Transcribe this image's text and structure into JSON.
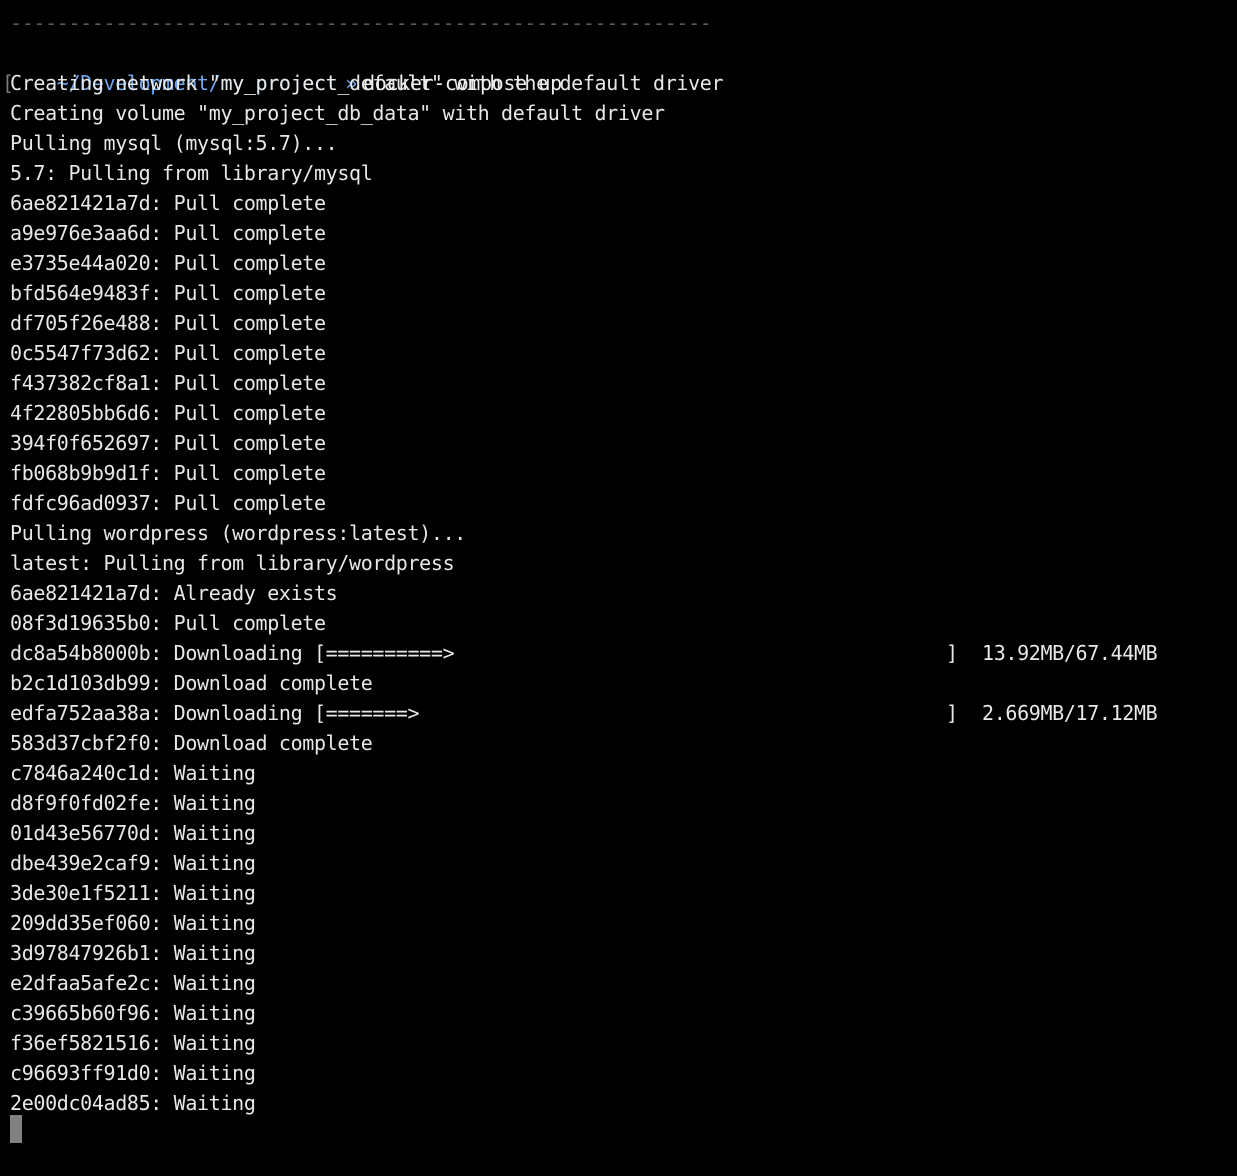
{
  "separator": "------------------------------------------------------------",
  "prompt": {
    "bracket": "[",
    "path": "~/Development/my_project",
    "arrow": "»",
    "command": "docker-compose up"
  },
  "lines": [
    "Creating network \"my_project_default\" with the default driver",
    "Creating volume \"my_project_db_data\" with default driver",
    "Pulling mysql (mysql:5.7)...",
    "5.7: Pulling from library/mysql",
    "6ae821421a7d: Pull complete",
    "a9e976e3aa6d: Pull complete",
    "e3735e44a020: Pull complete",
    "bfd564e9483f: Pull complete",
    "df705f26e488: Pull complete",
    "0c5547f73d62: Pull complete",
    "f437382cf8a1: Pull complete",
    "4f22805bb6d6: Pull complete",
    "394f0f652697: Pull complete",
    "fb068b9b9d1f: Pull complete",
    "fdfc96ad0937: Pull complete",
    "Pulling wordpress (wordpress:latest)...",
    "latest: Pulling from library/wordpress",
    "6ae821421a7d: Already exists",
    "08f3d19635b0: Pull complete"
  ],
  "download1": {
    "text": "dc8a54b8000b: Downloading [==========>",
    "bar_end": "]",
    "size": "13.92MB/67.44MB"
  },
  "line_b2c": "b2c1d103db99: Download complete",
  "download2": {
    "text": "edfa752aa38a: Downloading [=======>",
    "bar_end": "]",
    "size": "2.669MB/17.12MB"
  },
  "waiting_lines": [
    "583d37cbf2f0: Download complete",
    "c7846a240c1d: Waiting",
    "d8f9f0fd02fe: Waiting",
    "01d43e56770d: Waiting",
    "dbe439e2caf9: Waiting",
    "3de30e1f5211: Waiting",
    "209dd35ef060: Waiting",
    "3d97847926b1: Waiting",
    "e2dfaa5afe2c: Waiting",
    "c39665b60f96: Waiting",
    "f36ef5821516: Waiting",
    "c96693ff91d0: Waiting",
    "2e00dc04ad85: Waiting"
  ]
}
